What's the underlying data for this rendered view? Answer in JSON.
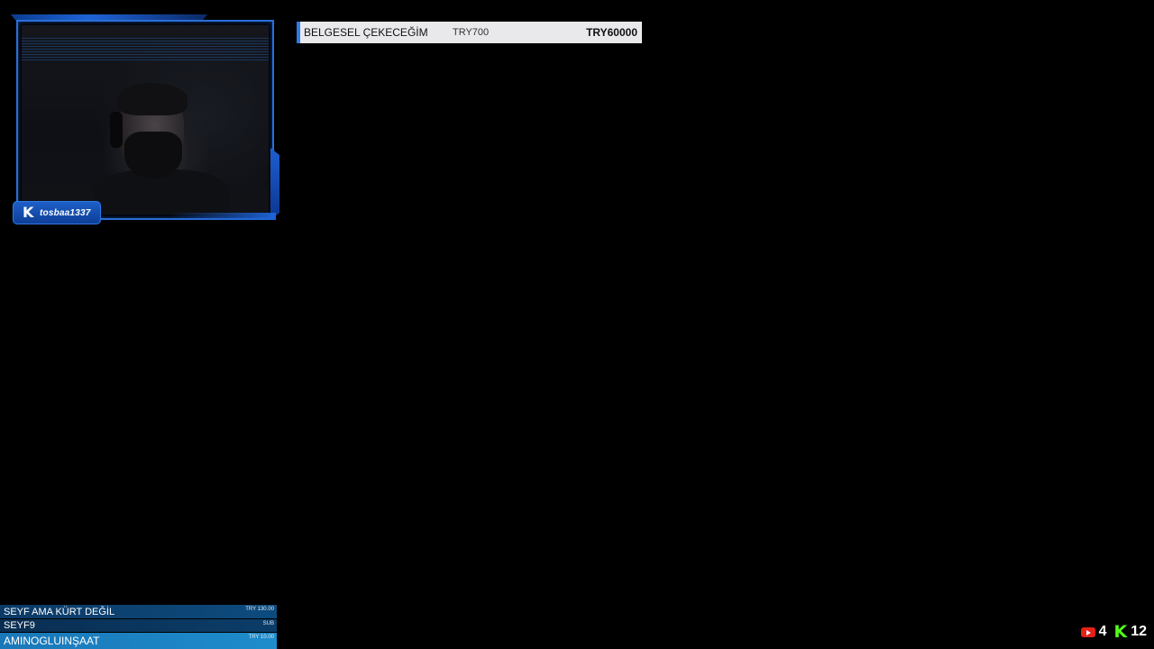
{
  "webcam": {
    "badge": {
      "platform_icon": "kick-logo-icon",
      "username": "tosbaa1337"
    }
  },
  "goal": {
    "title": "BELGESEL ÇEKECEĞİM",
    "current": "TRY700",
    "target": "TRY60000",
    "accent_color": "#2f7be8"
  },
  "events": [
    {
      "name": "SEYF AMA KÜRT DEĞİL",
      "amount": "TRY 130.00"
    },
    {
      "name": "SEYF9",
      "amount": "SUB"
    },
    {
      "name": "AMINOGLUINŞAAT",
      "amount": "TRY 10.00"
    }
  ],
  "viewers": {
    "youtube": {
      "icon": "youtube-icon",
      "count": "4",
      "color": "#e62117"
    },
    "kick": {
      "icon": "kick-icon",
      "count": "12",
      "color": "#53fc18"
    }
  }
}
